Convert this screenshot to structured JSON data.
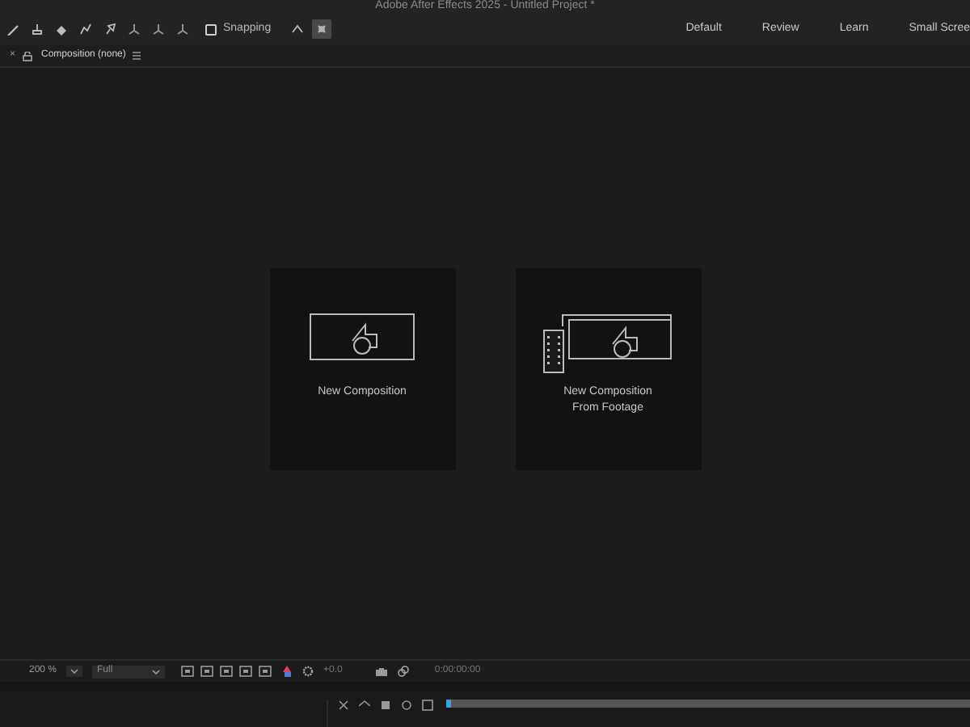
{
  "window": {
    "title": "Adobe After Effects 2025 - Untitled Project *"
  },
  "toolbar": {
    "snapping": {
      "label": "Snapping",
      "checked": false
    },
    "tools": [
      {
        "kind": "brush",
        "selected": false
      },
      {
        "kind": "stamp",
        "selected": false
      },
      {
        "kind": "eraser",
        "selected": false
      },
      {
        "kind": "roto",
        "selected": false
      },
      {
        "kind": "pin",
        "selected": false
      },
      {
        "kind": "axis",
        "selected": false
      },
      {
        "kind": "axis",
        "selected": false
      },
      {
        "kind": "axis",
        "selected": false
      },
      {
        "kind": "snap-a",
        "selected": false
      },
      {
        "kind": "snap-b",
        "selected": true
      }
    ]
  },
  "workspaces": [
    {
      "label": "Default"
    },
    {
      "label": "Review"
    },
    {
      "label": "Learn"
    },
    {
      "label": "Small Scree"
    }
  ],
  "panel": {
    "close": "×",
    "title": "Composition (none)"
  },
  "cards": [
    {
      "kind": "new",
      "label": "New Composition"
    },
    {
      "kind": "footage",
      "label": "New Composition\nFrom Footage"
    }
  ],
  "viewer_bar": {
    "zoom": "200 %",
    "resolution": "Full",
    "exposure": "+0.0",
    "timecode": "0:00:00:00"
  }
}
